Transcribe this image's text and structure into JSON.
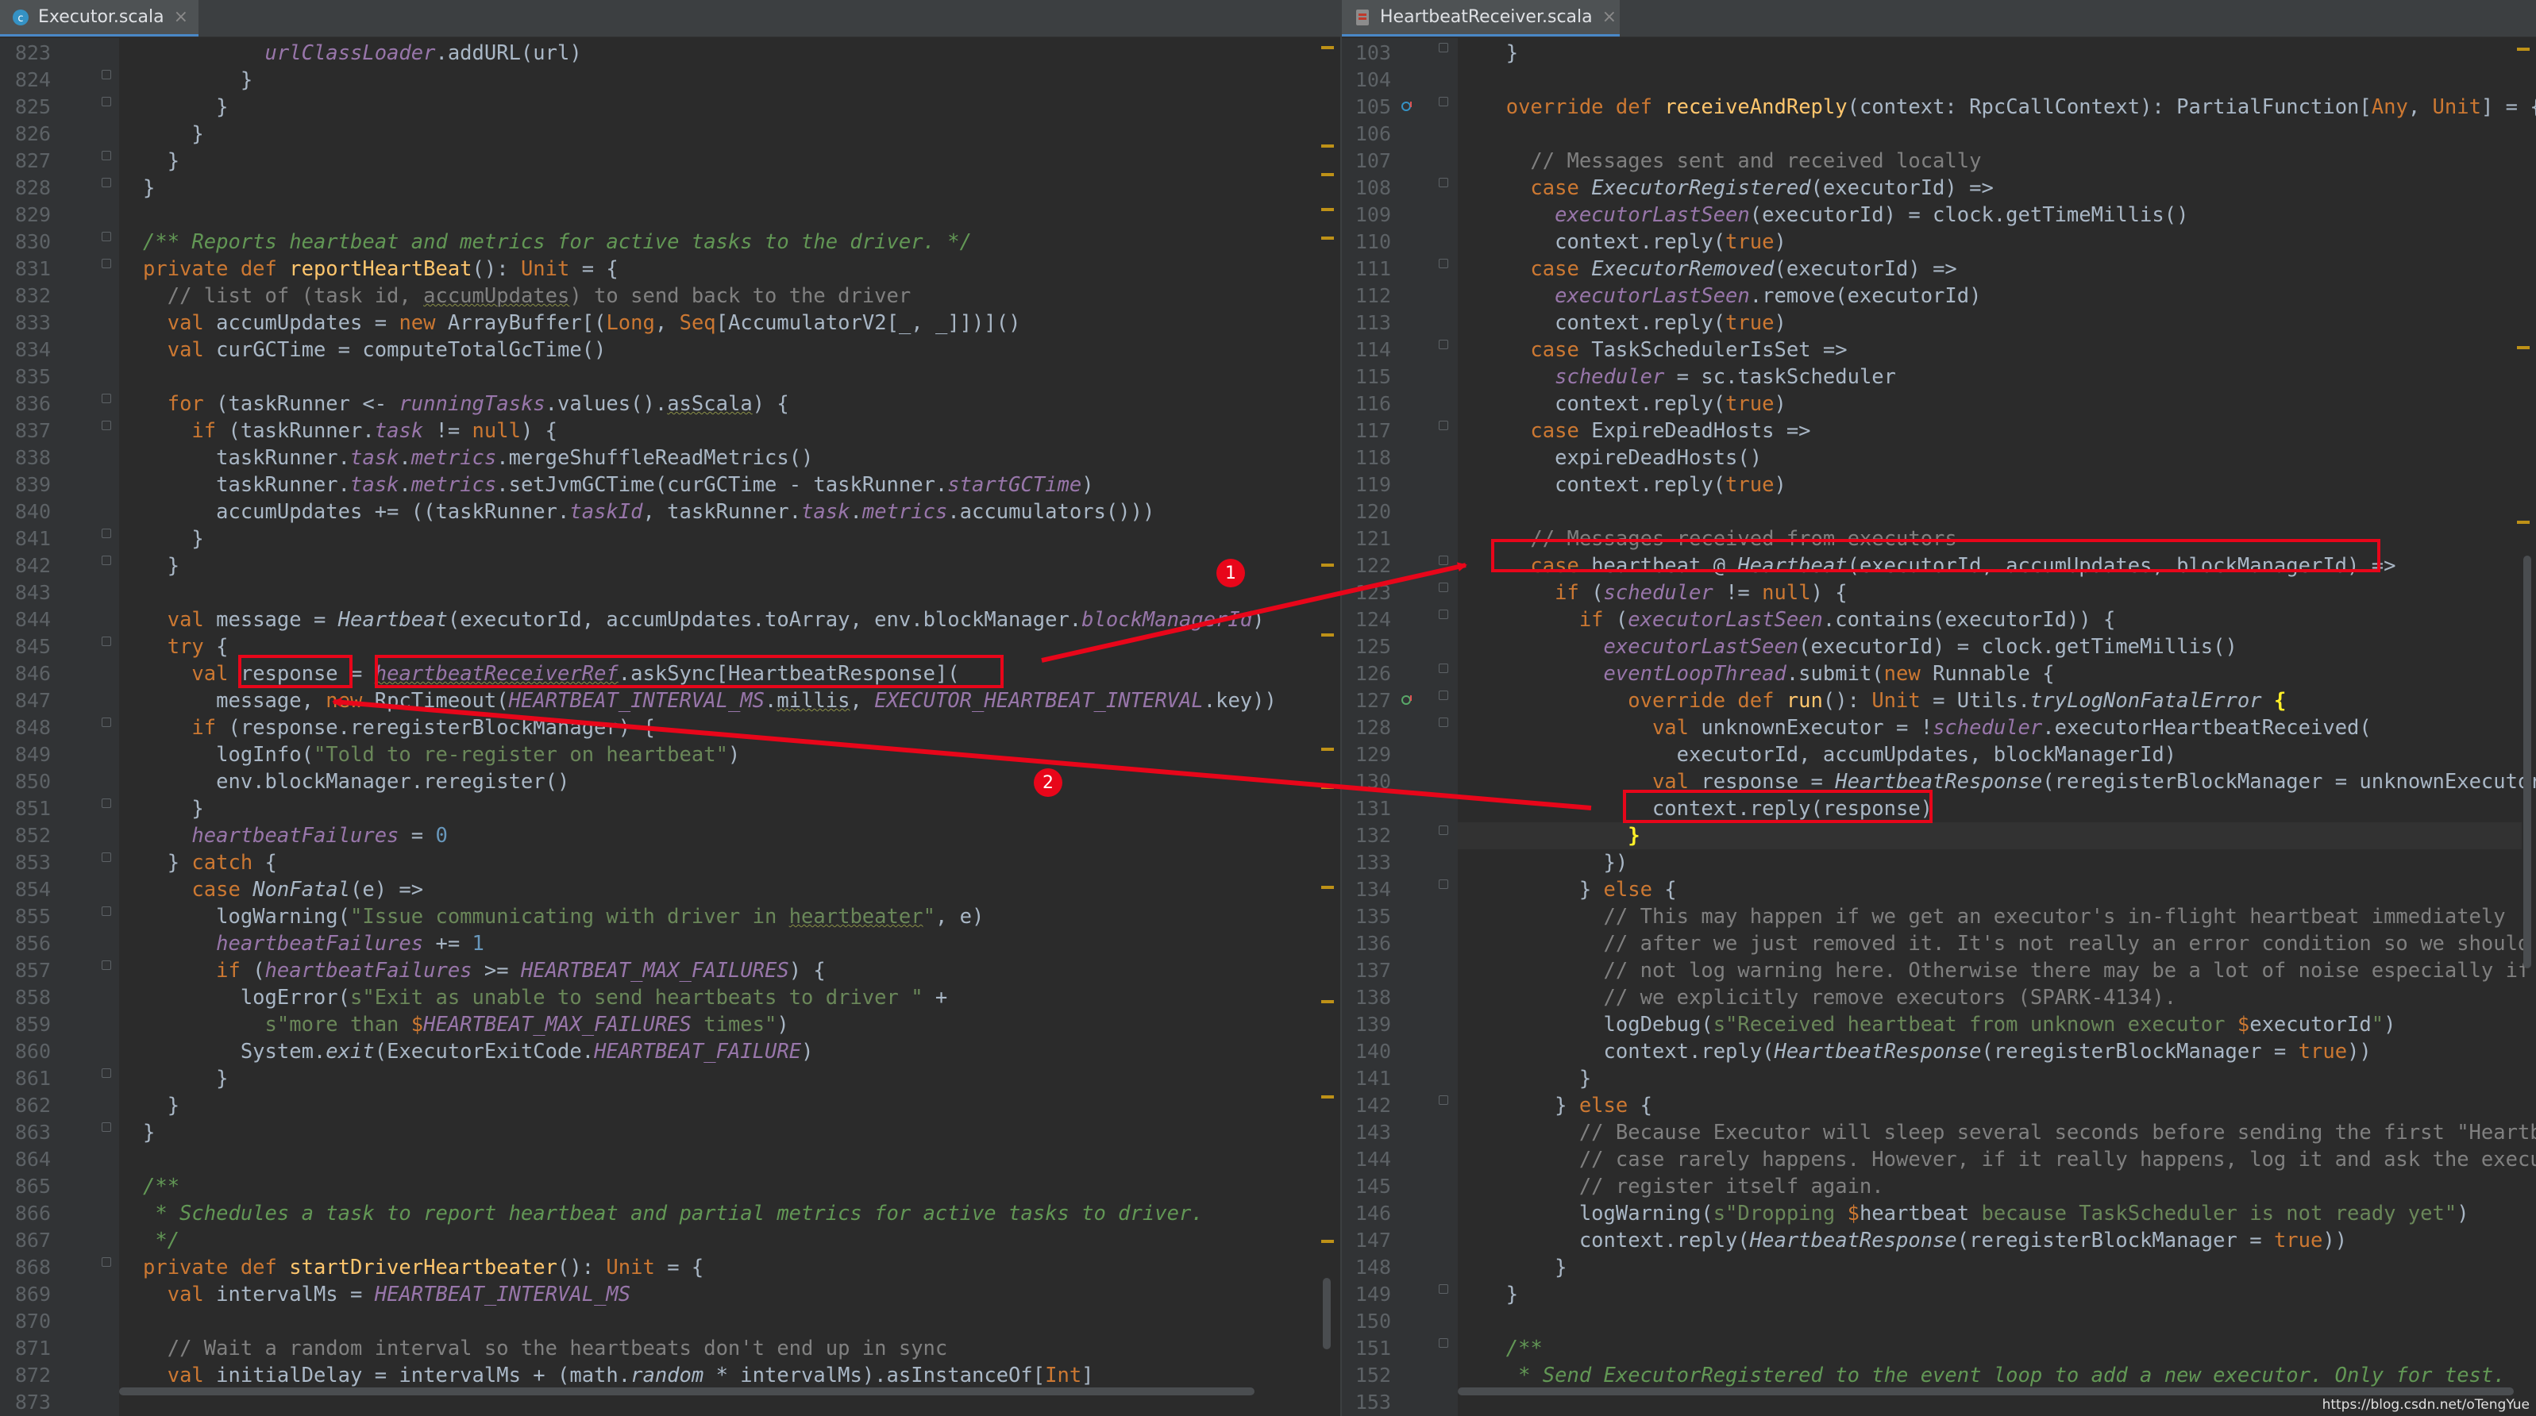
{
  "tabs": {
    "left": {
      "name": "Executor.scala",
      "close": "×",
      "icon": "scala-class-icon"
    },
    "right": {
      "name": "HeartbeatReceiver.scala",
      "close": "×",
      "icon": "scala-file-icon"
    }
  },
  "left": {
    "lines": [
      "823",
      "824",
      "825",
      "826",
      "827",
      "828",
      "829",
      "830",
      "831",
      "832",
      "833",
      "834",
      "835",
      "836",
      "837",
      "838",
      "839",
      "840",
      "841",
      "842",
      "843",
      "844",
      "845",
      "846",
      "847",
      "848",
      "849",
      "850",
      "851",
      "852",
      "853",
      "854",
      "855",
      "856",
      "857",
      "858",
      "859",
      "860",
      "861",
      "862",
      "863",
      "864",
      "865",
      "866",
      "867",
      "868",
      "869",
      "870",
      "871",
      "872",
      "873"
    ]
  },
  "right": {
    "lines": [
      "103",
      "104",
      "105",
      "106",
      "107",
      "108",
      "109",
      "110",
      "111",
      "112",
      "113",
      "114",
      "115",
      "116",
      "117",
      "118",
      "119",
      "120",
      "121",
      "122",
      "123",
      "124",
      "125",
      "126",
      "127",
      "128",
      "129",
      "130",
      "131",
      "132",
      "133",
      "134",
      "135",
      "136",
      "137",
      "138",
      "139",
      "140",
      "141",
      "142",
      "143",
      "144",
      "145",
      "146",
      "147",
      "148",
      "149",
      "150",
      "151",
      "152",
      "153"
    ]
  },
  "annotations": {
    "badge1": "1",
    "badge2": "2",
    "color": "#e8061a"
  },
  "watermark": "https://blog.csdn.net/oTengYue",
  "colors": {
    "background": "#2b2b2b",
    "keyword": "#cc7832",
    "comment": "#808080",
    "doc_comment": "#629755",
    "string": "#6a8759",
    "number": "#6897bb",
    "field": "#9876aa",
    "function": "#ffc66d",
    "default": "#a9b7c6"
  }
}
